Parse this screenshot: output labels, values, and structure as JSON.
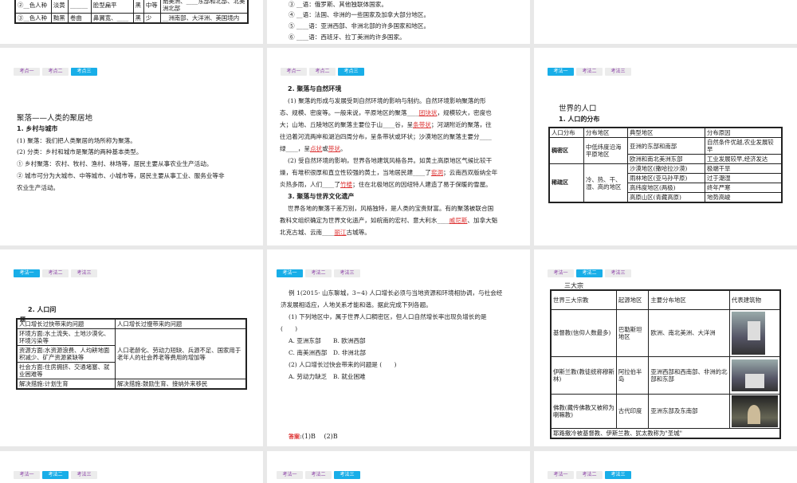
{
  "tabs_kaodian": [
    "考点一",
    "考点二",
    "考点三"
  ],
  "tabs_kaofa": [
    "考法一",
    "考法二",
    "考法三"
  ],
  "r1c1": {
    "rows": [
      [
        "②__色人种",
        "淡黄",
        "______",
        "脸型扁平",
        "黑",
        "中等",
        "南美洲、____东部和北部、北美洲北部"
      ],
      [
        "③__色人种",
        "黝黑",
        "卷曲",
        "鼻翼宽、____",
        "黑",
        "少",
        "__洲南部、大洋洲、美国境内"
      ]
    ]
  },
  "r1c2": {
    "lines": [
      "③ __语：俄罗斯、其他独联体国家。",
      "④ __语：法国、非洲的一些国家及加拿大部分地区。",
      "⑤ ____语：亚洲西部、非洲北部的许多国家和地区。",
      "⑥ ____语：西班牙、拉丁美洲的许多国家。"
    ]
  },
  "r2c1": {
    "title": "聚落——人类的聚居地",
    "sub": "1. 乡村与城市",
    "lines": [
      "(1) 聚落：我们把人类聚居的场所称为聚落。",
      "(2) 分类：乡村和城市是聚落的两种基本类型。",
      "① 乡村聚落：农村、牧村、渔村、林场等，居民主要从事农业生产活动。",
      "② 城市可分为大城市、中等城市、小城市等，居民主要从事工业、服务业等非",
      "农业生产活动。"
    ]
  },
  "r2c2": {
    "h1": "2. 聚落与自然环境",
    "p1": [
      "(1) 聚落的形成与发展受到自然环境的影响与制约。自然环境影响聚落的形",
      "态、规模、密度等。一般来说，平原地区的聚落____",
      "团块状",
      "，规模较大，密度也",
      "大；山地、丘陵地区的聚落主要位于山____谷，呈",
      "条带状",
      "；河湖附近的聚落，往",
      "往沿着河流两岸和湖泊四周分布，呈条带状或环状；沙漠地区的聚落主要分____",
      "绿____，呈",
      "点状",
      "或",
      "带状",
      "。"
    ],
    "p2": [
      "(2) 受自然环境的影响，世界各地建筑风格各异。如黄土高原地区气候比较干",
      "燥，有堆积很厚和直立性较强的黄土，当地居民建____了",
      "窑洞",
      "；云南西双版纳全年",
      "炎热多雨，人们____了",
      "竹楼",
      "；住在北极地区的因纽特人建造了易于保暖的雪屋。"
    ],
    "h2": "3. 聚落与世界文化遗产",
    "p3": [
      "世界各地的聚落千差万别，风格独特，是人类的宝贵财富。有的聚落被联合国",
      "教科文组织确定为世界文化遗产，如皖南的宏村、意大利水____",
      "威尼斯",
      "、加拿大魁",
      "北克古城、云南____",
      "丽江",
      "古城等。"
    ]
  },
  "r2c3": {
    "title": "世界的人口",
    "sub": "1. 人口的分布",
    "header": [
      "人口分布",
      "分布地区",
      "典型地区",
      "分布原因"
    ],
    "dense": "稠密区",
    "dense_area": "中低纬度沿海平原地区",
    "dense_rows": [
      [
        "亚洲的东部和南部",
        "自然条件优越,农业发展较早"
      ],
      [
        "欧洲和南北美洲东部",
        "工业发展较早,经济发达"
      ]
    ],
    "sparse": "稀疏区",
    "sparse_area": "冷、热、干、湿、高的地区",
    "sparse_rows": [
      [
        "沙漠地区(撒哈拉沙漠)",
        "极端干旱"
      ],
      [
        "雨林地区(亚马孙平原)",
        "过于潮湿"
      ],
      [
        "高纬度地区(两极)",
        "终年严寒"
      ],
      [
        "高原山区(青藏高原)",
        "地势高峻"
      ]
    ]
  },
  "r3c1": {
    "title": "2. 人口问",
    "title_tail": "题",
    "header": [
      "人口增长过快带来的问题",
      "人口增长过慢带来的问题"
    ],
    "left": [
      "环境方面:水土流失、土地沙漠化、环境污染等",
      "资源方面:水资源浪费、人均耕地面积减少、矿产资源紧缺等",
      "社会方面:住房拥挤、交通堵塞、就业困难等"
    ],
    "right": "人口老龄化、劳动力短缺、兵源不足、国家用于老年人的社会养老等费用的增加等",
    "foot": [
      "解决措施:计划生育",
      "解决措施:鼓励生育、接纳外来移民"
    ]
  },
  "r3c2": {
    "lines": [
      "例 1(2015· 山东聊城，3~4) 人口增长必须与当地资源和环境相协调，与社会经",
      "济发展相适应，人地关系才能和谐。据此完成下列各题。",
      "(1) 下列地区中，属于世界人口稠密区，但人口自然增长率出现负增长的是",
      "(　　)",
      "A. 亚洲东部　　B. 欧洲西部",
      "C. 南美洲西部　D. 非洲北部",
      "(2) 人口增长过快会带来的问题是 (　　)",
      "A. 劳动力缺乏　B. 就业困难"
    ],
    "answer_label": "答案",
    "answer": ":(1)B　 (2)B"
  },
  "r3c3": {
    "title": "三大宗",
    "header": [
      "世界三大宗教",
      "起源地区",
      "主要分布地区",
      "代表建筑物"
    ],
    "rows": [
      [
        "基督教(信仰人数最多)",
        "巴勒斯坦地区",
        "欧洲、南北美洲、大洋洲"
      ],
      [
        "伊斯兰教(教徒统称穆斯林)",
        "阿拉伯半岛",
        "亚洲西部和西南部、非洲的北部和东部"
      ],
      [
        "佛教(藏传佛教又被称为喇嘛教)",
        "古代印度",
        "亚洲东部及东南部"
      ]
    ],
    "foot": "耶路撒冷被基督教、伊斯兰教、犹太教称为\"圣城\""
  }
}
